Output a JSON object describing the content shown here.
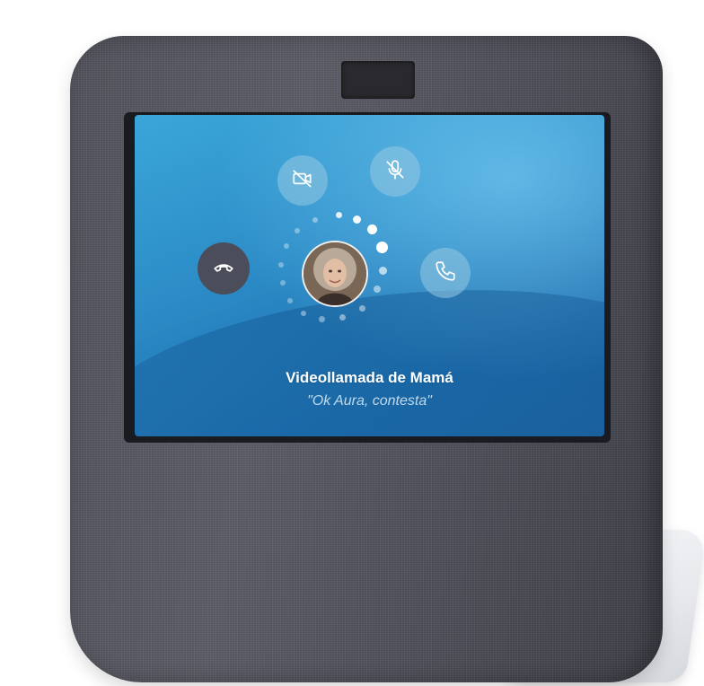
{
  "call": {
    "caller_title": "Videollamada de Mamá",
    "voice_hint": "\"Ok Aura, contesta\""
  },
  "controls": {
    "camera_off_icon": "video-off-icon",
    "mic_off_icon": "mic-off-icon",
    "decline_icon": "phone-hangup-icon",
    "accept_icon": "phone-icon"
  },
  "colors": {
    "screen_blue": "#2c8cc7",
    "decline_button": "#4b4e5a",
    "fabric": "#52535c"
  }
}
